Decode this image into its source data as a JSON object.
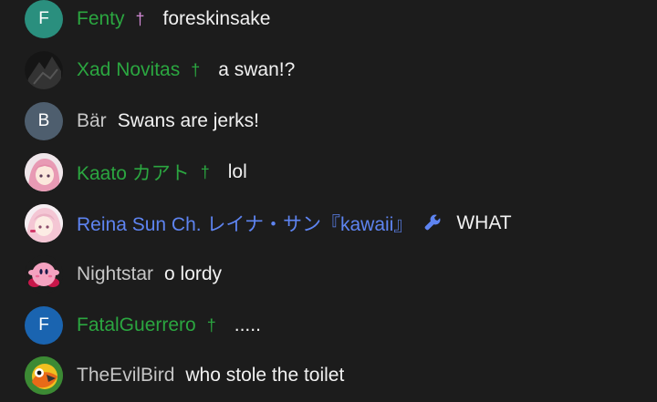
{
  "colors": {
    "background": "#1c1c1c",
    "member_name": "#2ba640",
    "moderator_name": "#5e84f1",
    "plain_name": "#c6c6c6",
    "message_text": "#f1f1f1"
  },
  "messages": [
    {
      "author": "Fenty",
      "avatar_letter": "F",
      "avatar_color": "#2a8f7e",
      "badge": "†",
      "badge_type": "member-badge-icon",
      "text": "foreskinsake"
    },
    {
      "author": "Xad Novitas",
      "avatar_letter": "",
      "avatar_color": "#2a2a2a",
      "badge": "†",
      "badge_type": "member-badge-icon",
      "text": "a swan!?"
    },
    {
      "author": "Bär",
      "avatar_letter": "B",
      "avatar_color": "#4e5e6e",
      "badge": "",
      "badge_type": "",
      "text": "Swans are jerks!"
    },
    {
      "author": "Kaato カアト",
      "avatar_letter": "",
      "avatar_color": "#e8c8d4",
      "badge": "†",
      "badge_type": "member-badge-icon",
      "text": "lol"
    },
    {
      "author": "Reina Sun Ch. レイナ・サン『kawaii』",
      "avatar_letter": "",
      "avatar_color": "#f0dce4",
      "badge": "🔧",
      "badge_type": "wrench-icon",
      "text": "WHAT"
    },
    {
      "author": "Nightstar",
      "avatar_letter": "",
      "avatar_color": "#1c1c1c",
      "badge": "",
      "badge_type": "",
      "text": "o lordy"
    },
    {
      "author": "FatalGuerrero",
      "avatar_letter": "F",
      "avatar_color": "#1a64b0",
      "badge": "†",
      "badge_type": "member-badge-icon",
      "text": "....."
    },
    {
      "author": "TheEvilBird",
      "avatar_letter": "",
      "avatar_color": "#2b7a2b",
      "badge": "",
      "badge_type": "",
      "text": "who stole the toilet"
    }
  ]
}
